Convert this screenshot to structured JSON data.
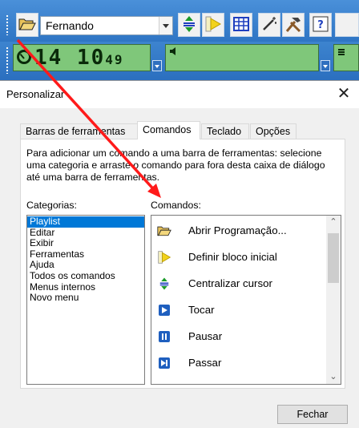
{
  "toolbar": {
    "user_combo_value": "Fernando",
    "lcd_time": "14 10",
    "lcd_seconds": "49",
    "icons": [
      "folder-open-icon",
      "center-cursor-icon",
      "set-block-start-icon",
      "grid-icon",
      "magic-wand-icon",
      "tools-icon",
      "help-icon"
    ]
  },
  "dialog": {
    "title": "Personalizar",
    "close_glyph": "✕",
    "tabs": [
      {
        "label": "Barras de ferramentas",
        "active": false
      },
      {
        "label": "Comandos",
        "active": true
      },
      {
        "label": "Teclado",
        "active": false
      },
      {
        "label": "Opções",
        "active": false
      }
    ],
    "description": "Para adicionar um comando a uma barra de ferramentas: selecione uma categoria e arraste o comando para fora desta caixa de diálogo até uma barra de ferramentas.",
    "categories_label": "Categorias:",
    "commands_label": "Comandos:",
    "categories": [
      "Playlist",
      "Editar",
      "Exibir",
      "Ferramentas",
      "Ajuda",
      "Todos os comandos",
      "Menus internos",
      "Novo menu"
    ],
    "selected_category": "Playlist",
    "commands": [
      {
        "label": "Abrir Programação...",
        "icon": "folder-open-icon"
      },
      {
        "label": "Definir bloco inicial",
        "icon": "set-block-start-icon"
      },
      {
        "label": "Centralizar cursor",
        "icon": "center-cursor-icon"
      },
      {
        "label": "Tocar",
        "icon": "play-icon"
      },
      {
        "label": "Pausar",
        "icon": "pause-icon"
      },
      {
        "label": "Passar",
        "icon": "skip-icon"
      }
    ],
    "close_button": "Fechar"
  },
  "colors": {
    "toolbar_blue": "#2f75c4",
    "lcd_green": "#7fc77a",
    "selection": "#0078d7",
    "annotation_arrow": "#ff0000"
  }
}
